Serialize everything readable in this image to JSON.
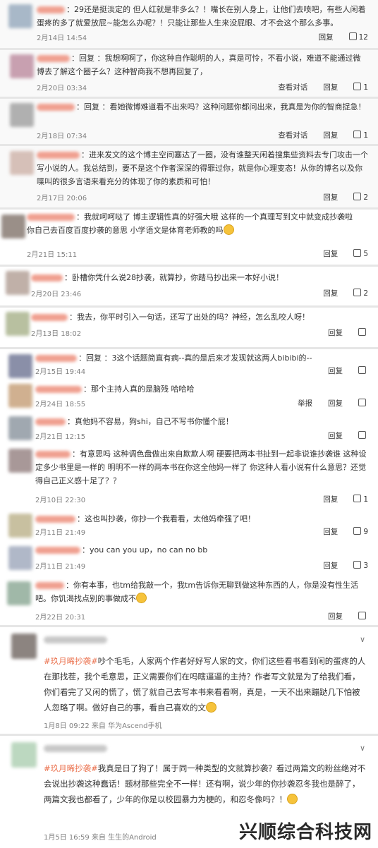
{
  "comments": [
    {
      "text": "：29还是挺淡定的 但人红就是非多么？！嘴长在别人身上，让他们去喷吧，有些人闲着蛋疼的多了就爱放屁~能怎么办呢？！只能让那些人生来没屁眼、才不会这个那么多事。",
      "time": "2月14日 14:54",
      "actions": [
        "回复"
      ],
      "likes": "12"
    },
    {
      "text": "：回复 ：我想啊啊了，你这种自作聪明的人，真是可怜，不看小说，难道不能通过微博去了解这个圈子么？这种智商我不想再回复了，",
      "time": "2月20日 03:34",
      "actions": [
        "查看对话",
        "回复"
      ],
      "likes": "1"
    },
    {
      "text": "：回复 ：看她微博难道看不出来吗？这种问题你都问出来，我真是为你的智商捉急！",
      "time": "2月18日 07:34",
      "actions": [
        "查看对话",
        "回复"
      ],
      "likes": "1"
    },
    {
      "text": "：进来发文的这个博主空间塞达了一圈，没有谁整天闲着搜集些资料去专门攻击一个写小说的人。我总结到，要不是这个作者深深的得罪过你，就是你心理变态！从你的博名以及你喋叫的很多言语来看充分的体现了你的素质和可怕！",
      "time": "2月17日 20:06",
      "actions": [
        "回复"
      ],
      "likes": "2"
    },
    {
      "text": "：我就呵呵哒了 博主逻辑性真的好强大哦 这样的一个真理写到文中就变成抄袭啦 你自己去百度百度抄袭的意思 小学语文是体育老师教的吗",
      "time": "2月21日 15:11",
      "actions": [
        "回复"
      ],
      "likes": "5"
    },
    {
      "text": "：卧槽你凭什么说28抄袭，就算抄，你踏马抄出来一本好小说！",
      "time": "2月20日 23:46",
      "actions": [
        "回复"
      ],
      "likes": "2"
    },
    {
      "text": "：我去，你平时引入一句话，还写了出处的吗？神经，怎么乱咬人呀！",
      "time": "2月13日 18:02",
      "actions": [
        "回复"
      ],
      "likes": ""
    },
    {
      "text": "：回复 ：3这个话题简直有病--真的是后来才发现就这两人bibibi的--",
      "time": "2月15日 19:44",
      "actions": [
        "回复"
      ],
      "likes": ""
    },
    {
      "text": "：那个主持人真的是脑残 哈哈哈",
      "time": "2月24日 18:55",
      "actions": [
        "举报",
        "回复"
      ],
      "likes": ""
    },
    {
      "text": "：真他妈不容易，狗shi，自己不写书你懂个屁！",
      "time": "2月21日 12:15",
      "actions": [
        "回复"
      ],
      "likes": ""
    },
    {
      "text": "：有意思吗 这种调色盘做出来自欺欺人啊 硬要把两本书扯到一起非说谁抄袭谁 这种设定多少书里是一样的 明明不一样的两本书在你这全他妈一样了 你这种人看小说有什么意思？还觉得自己正义感十足了？？",
      "time": "2月10日 22:30",
      "actions": [
        "回复"
      ],
      "likes": "1"
    },
    {
      "text": "：这也叫抄袭，你抄一个我看看，太他妈牵强了吧！",
      "time": "2月11日 21:49",
      "actions": [
        "回复"
      ],
      "likes": "9"
    },
    {
      "text": "：you can you up，no can no bb",
      "time": "2月11日 21:49",
      "actions": [
        "回复"
      ],
      "likes": "3"
    },
    {
      "text": "：你有本事，也tm给我敲一个，我tm告诉你无聊到做这种东西的人，你是没有性生活吧。你饥渴找点别的事做成不",
      "time": "2月22日 20:31",
      "actions": [
        "回复"
      ],
      "likes": ""
    }
  ],
  "posts": [
    {
      "tag": "#玖月晞抄袭#",
      "text": "吵个毛毛，人家两个作者好好写人家的文，你们这些看书看到闲的蛋疼的人在那找茬，我个毛意思，正义需要你们在吗瞎逼逼的主持？作者写文就是为了给我们看，你们看完了又闲的慌了，慌了就自己去写本书来看看啊，真是，一天不出来蹦跶几下怕被人忽略了啊。做好自己的事，看自己喜欢的文",
      "meta": "1月8日 09:22 来自 华为Ascend手机"
    },
    {
      "tag": "#玖月晞抄袭#",
      "text": "我真是日了狗了！属于同一种类型的文就算抄袭？看过两篇文的粉丝绝对不会说出抄袭这种蠢话！题材那些完全不一样！还有啊，说少年的你抄袭忍冬我也是醉了，两篇文我也都看了，少年的你是以校园暴力为梗的，和忍冬像吗？！",
      "meta": "1月5日 16:59 来自 生生的Android"
    }
  ],
  "watermark": "兴顺综合科技网",
  "colors": {
    "accent": "#eb7350",
    "meta": "#808080",
    "separator": "#e6e6e6"
  }
}
